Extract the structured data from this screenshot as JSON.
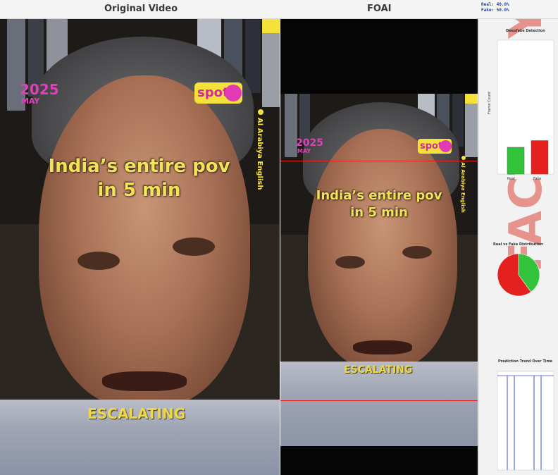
{
  "header": {
    "left_title": "Original Video",
    "mid_title": "FOAI",
    "stats": {
      "real": "Real: 40.0%",
      "fake": "Fake: 50.0%"
    }
  },
  "video": {
    "year": "2025",
    "month": "MAY",
    "brand": "spot",
    "channel": "Al Arabiya English",
    "caption_line1": "India’s entire pov",
    "caption_line2": "in 5 min",
    "lower_word": "ESCALATING"
  },
  "panel": {
    "bar_title": "Deepfake Detection",
    "bar_ylabel": "Frame Count",
    "bar_cat_real": "Real",
    "bar_cat_fake": "Fake",
    "pie_title": "Real vs Fake Distribution",
    "trend_title": "Prediction Trend Over Time",
    "watermark": "FACTOFFY",
    "colors": {
      "real": "#33c33a",
      "fake": "#e4211e"
    }
  },
  "chart_data": [
    {
      "type": "bar",
      "title": "Deepfake Detection",
      "ylabel": "Frame Count",
      "categories": [
        "Real",
        "Fake"
      ],
      "values": [
        4,
        5
      ],
      "ylim": [
        0,
        20
      ]
    },
    {
      "type": "pie",
      "title": "Real vs Fake Distribution",
      "categories": [
        "Real",
        "Fake"
      ],
      "values": [
        40,
        60
      ]
    }
  ]
}
